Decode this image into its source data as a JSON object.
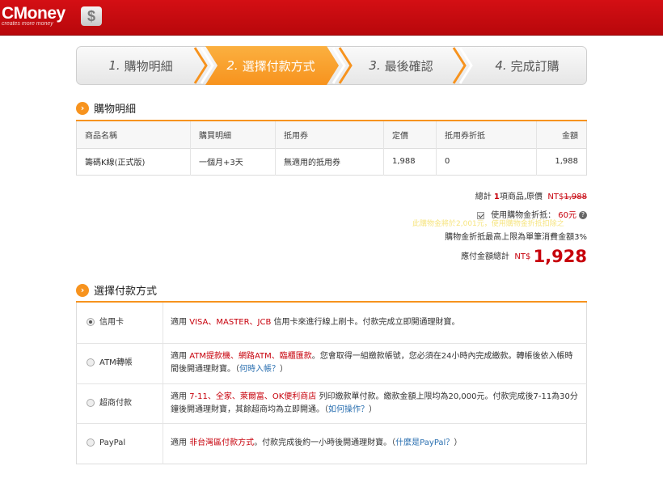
{
  "brand": {
    "name": "CMoney",
    "tagline": "creates more money",
    "badge": "$"
  },
  "steps": [
    {
      "num": "1.",
      "label": "購物明細"
    },
    {
      "num": "2.",
      "label": "選擇付款方式"
    },
    {
      "num": "3.",
      "label": "最後確認"
    },
    {
      "num": "4.",
      "label": "完成訂購"
    }
  ],
  "order": {
    "title": "購物明細",
    "headers": [
      "商品名稱",
      "購買明細",
      "抵用券",
      "定價",
      "抵用券折抵",
      "金額"
    ],
    "row": [
      "籌碼K線(正式版)",
      "一個月+3天",
      "無適用的抵用券",
      "1,988",
      "0",
      "1,988"
    ]
  },
  "summary": {
    "count_prefix": "總計",
    "count": "1",
    "count_suffix": "項商品,原價",
    "orig_currency": "NT$",
    "orig_price": "1,988",
    "use_credit_label": "使用購物金折抵：",
    "credit_amount": "60元",
    "credit_note_faint": "此購物金將於2,001元，使用購物金折抵扣除之",
    "limit_note": "購物金折抵最高上限為單筆消費金額3%",
    "total_label": "應付金額總計",
    "total_currency": "NT$",
    "total": "1,928"
  },
  "payment": {
    "title": "選擇付款方式",
    "options": [
      {
        "label": "信用卡",
        "selected": true,
        "pre": "適用 ",
        "hl": "VISA、MASTER、JCB",
        "post": " 信用卡來進行線上刷卡。付款完成立即開通理財寶。",
        "link": "",
        "tail": ""
      },
      {
        "label": "ATM轉帳",
        "selected": false,
        "pre": "適用 ",
        "hl": "ATM提款機、網路ATM、臨櫃匯款",
        "post": "。您會取得一組繳款帳號，您必須在24小時內完成繳款。轉帳後依入帳時間後開通理財寶。（",
        "link": "何時入帳？",
        "tail": "）"
      },
      {
        "label": "超商付款",
        "selected": false,
        "pre": "適用 ",
        "hl": "7-11、全家、萊爾富、OK便利商店",
        "post": " 列印繳款單付款。繳款金額上限均為20,000元。付款完成後7-11為30分鐘後開通理財寶，其餘超商均為立即開通。（",
        "link": "如何操作？",
        "tail": "）"
      },
      {
        "label": "PayPal",
        "selected": false,
        "pre": "適用 ",
        "hl": "非台灣區付款方式",
        "post": "。付款完成後約一小時後開通理財寶。（",
        "link": "什麼是PayPal？",
        "tail": "）"
      }
    ]
  },
  "colors": {
    "brand_red": "#c7000b",
    "accent_orange": "#f7931e",
    "link_blue": "#2a6fb0"
  }
}
